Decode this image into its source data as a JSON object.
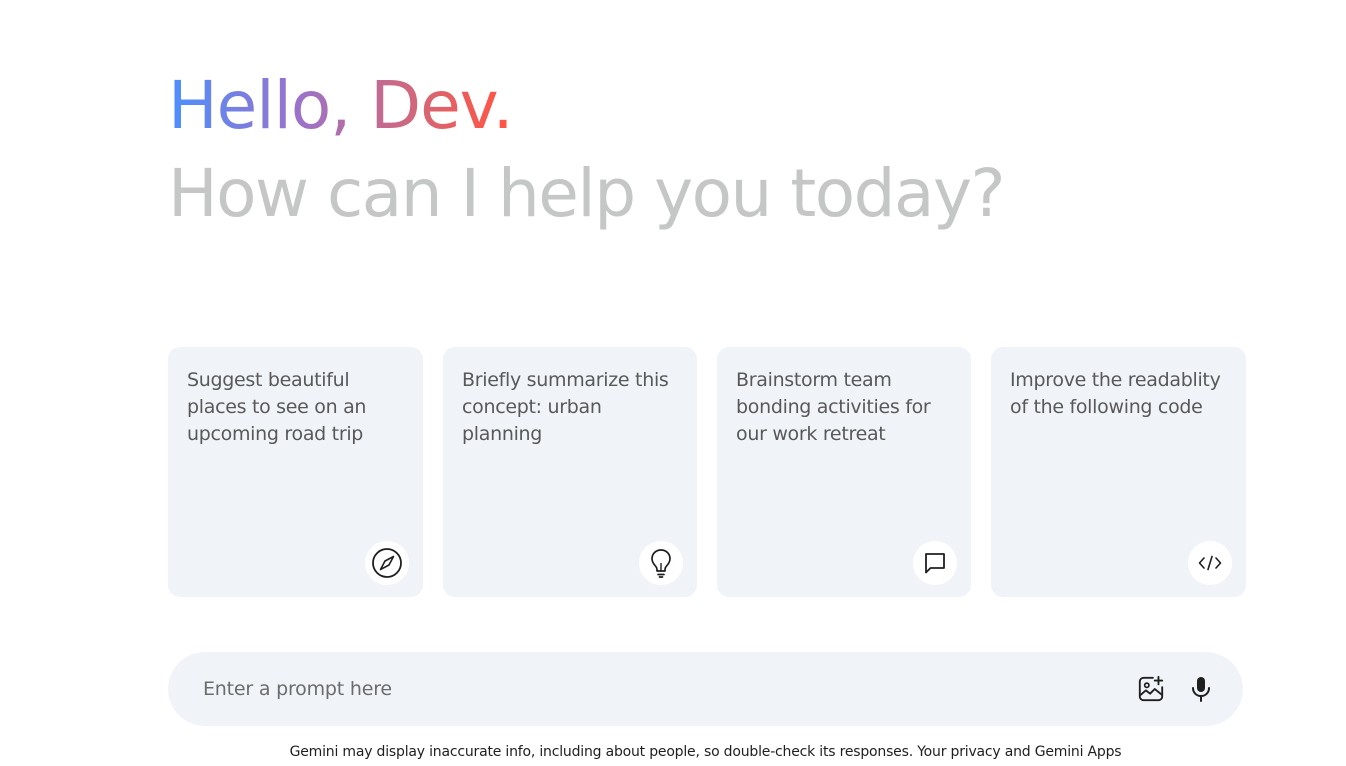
{
  "greeting": {
    "hello": "Hello, Dev.",
    "subtitle": "How can I help you today?",
    "gradient_colors": [
      "#4b90ff",
      "#9b72cb",
      "#d96570",
      "#ff5546"
    ]
  },
  "cards": [
    {
      "text": "Suggest beautiful places to see on an upcoming road trip",
      "icon": "compass-icon"
    },
    {
      "text": "Briefly summarize this concept: urban planning",
      "icon": "bulb-icon"
    },
    {
      "text": "Brainstorm team bonding activities for our work retreat",
      "icon": "message-icon"
    },
    {
      "text": "Improve the readablity of the following code",
      "icon": "code-icon"
    }
  ],
  "prompt": {
    "placeholder": "Enter a prompt here",
    "value": "",
    "icons": [
      "image-upload-icon",
      "mic-icon"
    ]
  },
  "disclaimer": "Gemini may display inaccurate info, including about people, so double-check its responses. Your privacy and Gemini Apps",
  "colors": {
    "card_bg": "#f0f4f9",
    "subtitle": "#c4c7c5",
    "card_text": "#585858"
  }
}
